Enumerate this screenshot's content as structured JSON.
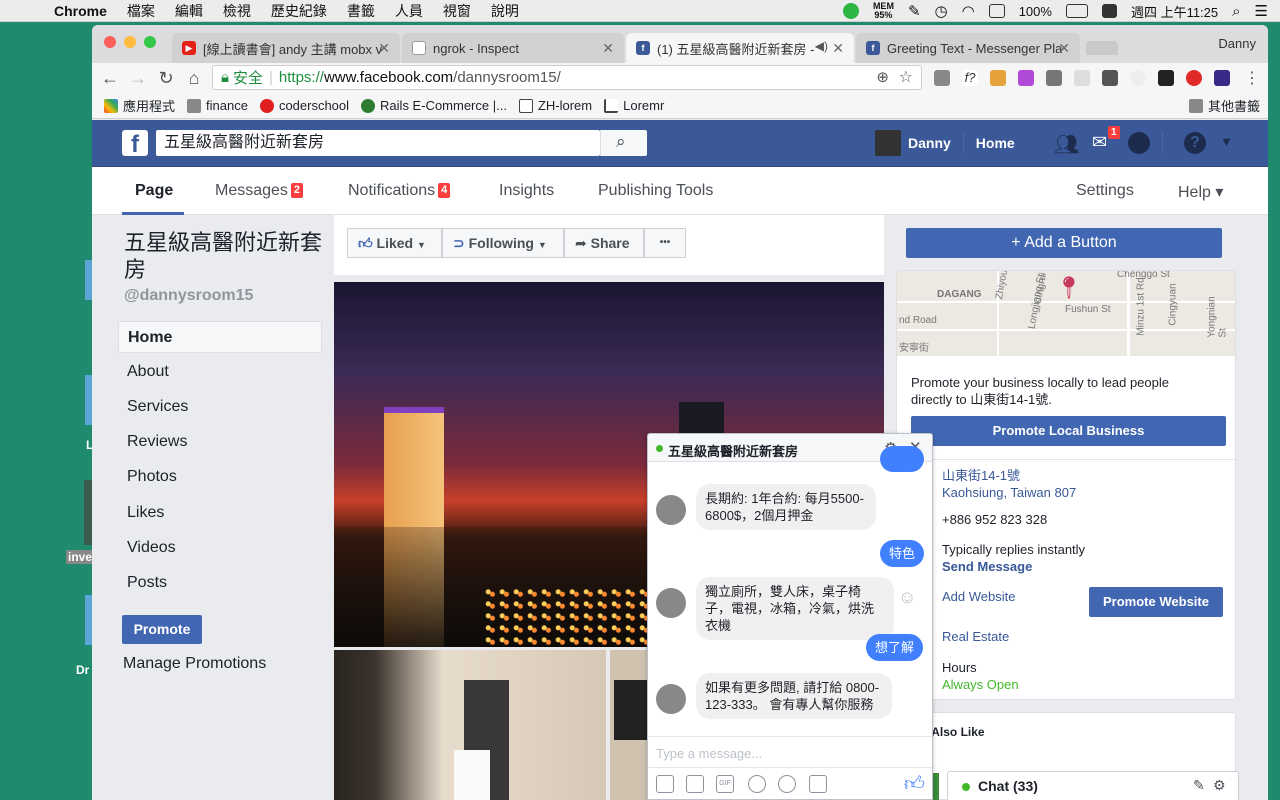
{
  "menubar": {
    "app": "Chrome",
    "items": [
      "檔案",
      "編輯",
      "檢視",
      "歷史紀錄",
      "書籤",
      "人員",
      "視窗",
      "說明"
    ],
    "mem_label": "MEM",
    "mem_value": "95%",
    "battery": "100%",
    "clock": "週四 上午11:25"
  },
  "desktop": {
    "labels": [
      "inve",
      "Dr",
      "L"
    ]
  },
  "browser": {
    "profile": "Danny",
    "tabs": [
      {
        "title": "[線上讀書會] andy 主講 mobx v",
        "icon": "youtube-icon",
        "active": false
      },
      {
        "title": "ngrok - Inspect",
        "icon": "page-icon",
        "active": false
      },
      {
        "title": "(1) 五星級高醫附近新套房 -",
        "icon": "facebook-icon",
        "active": true
      },
      {
        "title": "Greeting Text - Messenger Pla",
        "icon": "facebook-icon",
        "active": false
      }
    ],
    "secure_label": "安全",
    "url_scheme": "https://",
    "url_host": "www.facebook.com",
    "url_path": "/dannysroom15/",
    "bookmarks": [
      "應用程式",
      "finance",
      "coderschool",
      "Rails E-Commerce |...",
      "ZH-lorem",
      "Loremr"
    ],
    "other_bookmarks": "其他書籤"
  },
  "fb": {
    "search_value": "五星級高醫附近新套房",
    "user_name": "Danny",
    "home_label": "Home",
    "messenger_badge": "1",
    "nav": {
      "page": "Page",
      "messages": "Messages",
      "messages_count": "2",
      "notifications": "Notifications",
      "notifications_count": "4",
      "insights": "Insights",
      "publishing": "Publishing Tools",
      "settings": "Settings",
      "help": "Help ▾"
    },
    "page_name": "五星級高醫附近新套房",
    "page_handle": "@dannysroom15",
    "left_nav": [
      "Home",
      "About",
      "Services",
      "Reviews",
      "Photos",
      "Likes",
      "Videos",
      "Posts"
    ],
    "promote": "Promote",
    "manage_promotions": "Manage Promotions",
    "actions": {
      "liked": "Liked",
      "following": "Following",
      "share": "Share",
      "more": "•••",
      "add_button": "+ Add a Button"
    },
    "right": {
      "map_streets": [
        "Chenggo St",
        "DAGANG",
        "Zhiyou",
        "Longjiang St",
        "Cingrui",
        "Fushun St",
        "Minzu 1st Rd",
        "Cingyuan",
        "Yongnian St",
        "nd Road",
        "安寧街"
      ],
      "promo_text": "Promote your business locally to lead people directly to 山東街14-1號.",
      "promote_local": "Promote Local Business",
      "address1": "山東街14-1號",
      "address2": "Kaohsiung, Taiwan 807",
      "phone": "+886 952 823 328",
      "replies": "Typically replies instantly",
      "send_message": "Send Message",
      "add_website": "Add Website",
      "promote_website": "Promote Website",
      "category": "Real Estate",
      "hours_label": "Hours",
      "hours_value": "Always Open",
      "people_also_like": "ple Also Like"
    },
    "chat": {
      "title": "五星級高醫附近新套房",
      "messages": [
        {
          "from": "page",
          "text": "長期約: 1年合約: 每月5500-6800$，2個月押金"
        },
        {
          "from": "me",
          "text": "特色"
        },
        {
          "from": "page",
          "text": "獨立廁所，雙人床，桌子椅子，電視，冰箱，冷氣，烘洗衣機"
        },
        {
          "from": "me",
          "text": "想了解"
        },
        {
          "from": "page",
          "text": "如果有更多問題, 請打給 0800-123-333。 會有專人幫你服務"
        }
      ],
      "input_placeholder": "Type a message..."
    },
    "chatbar": "Chat (33)"
  }
}
